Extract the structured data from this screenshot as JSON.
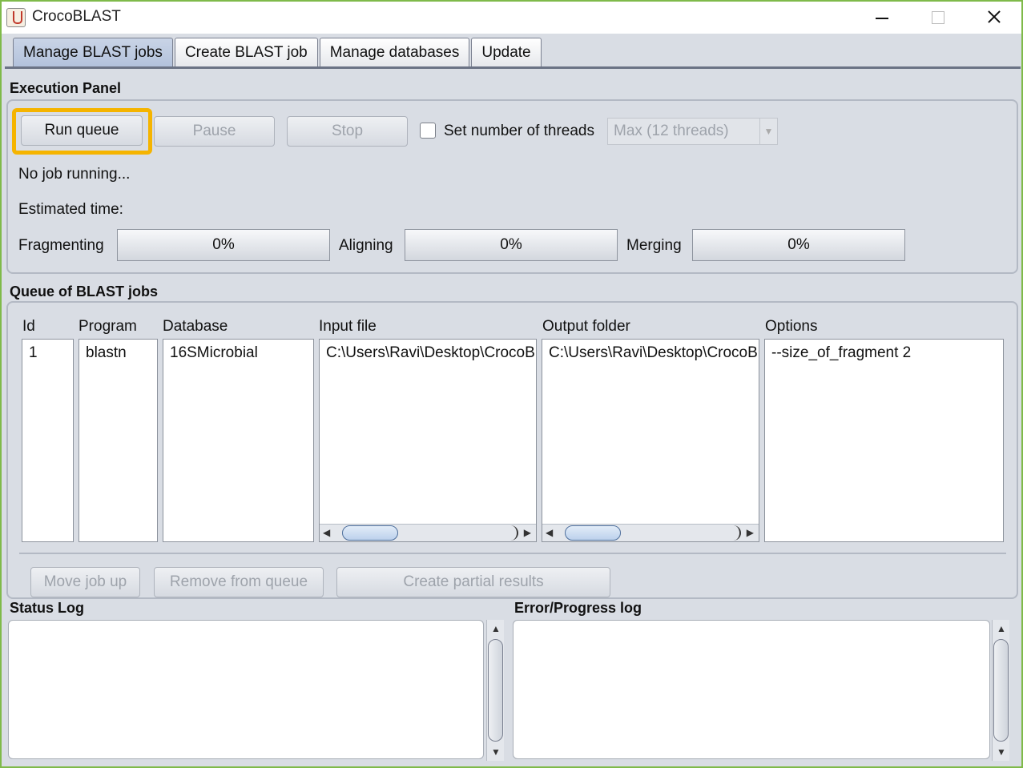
{
  "window": {
    "title": "CrocoBLAST"
  },
  "tabs": [
    {
      "label": "Manage BLAST jobs",
      "active": true
    },
    {
      "label": "Create BLAST job"
    },
    {
      "label": "Manage databases"
    },
    {
      "label": "Update"
    }
  ],
  "execution": {
    "title": "Execution Panel",
    "run_label": "Run queue",
    "pause_label": "Pause",
    "stop_label": "Stop",
    "threads_label": "Set number of threads",
    "threads_value": "Max (12 threads)",
    "status": "No job running...",
    "estimated": "Estimated time:",
    "fragmenting_label": "Fragmenting",
    "fragmenting_value": "0%",
    "aligning_label": "Aligning",
    "aligning_value": "0%",
    "merging_label": "Merging",
    "merging_value": "0%"
  },
  "queue": {
    "title": "Queue of BLAST jobs",
    "columns": [
      "Id",
      "Program",
      "Database",
      "Input file",
      "Output folder",
      "Options"
    ],
    "rows": [
      [
        "1",
        "blastn",
        "16SMicrobial",
        "C:\\Users\\Ravi\\Desktop\\CrocoBLAST",
        "C:\\Users\\Ravi\\Desktop\\CrocoBLAST",
        "--size_of_fragment 2"
      ]
    ],
    "move_up_label": "Move job up",
    "remove_label": "Remove from queue",
    "partial_label": "Create partial results"
  },
  "logs": {
    "status_title": "Status Log",
    "error_title": "Error/Progress log"
  },
  "colors": {
    "highlight": "#f5b400",
    "window_border": "#7fba4a"
  }
}
